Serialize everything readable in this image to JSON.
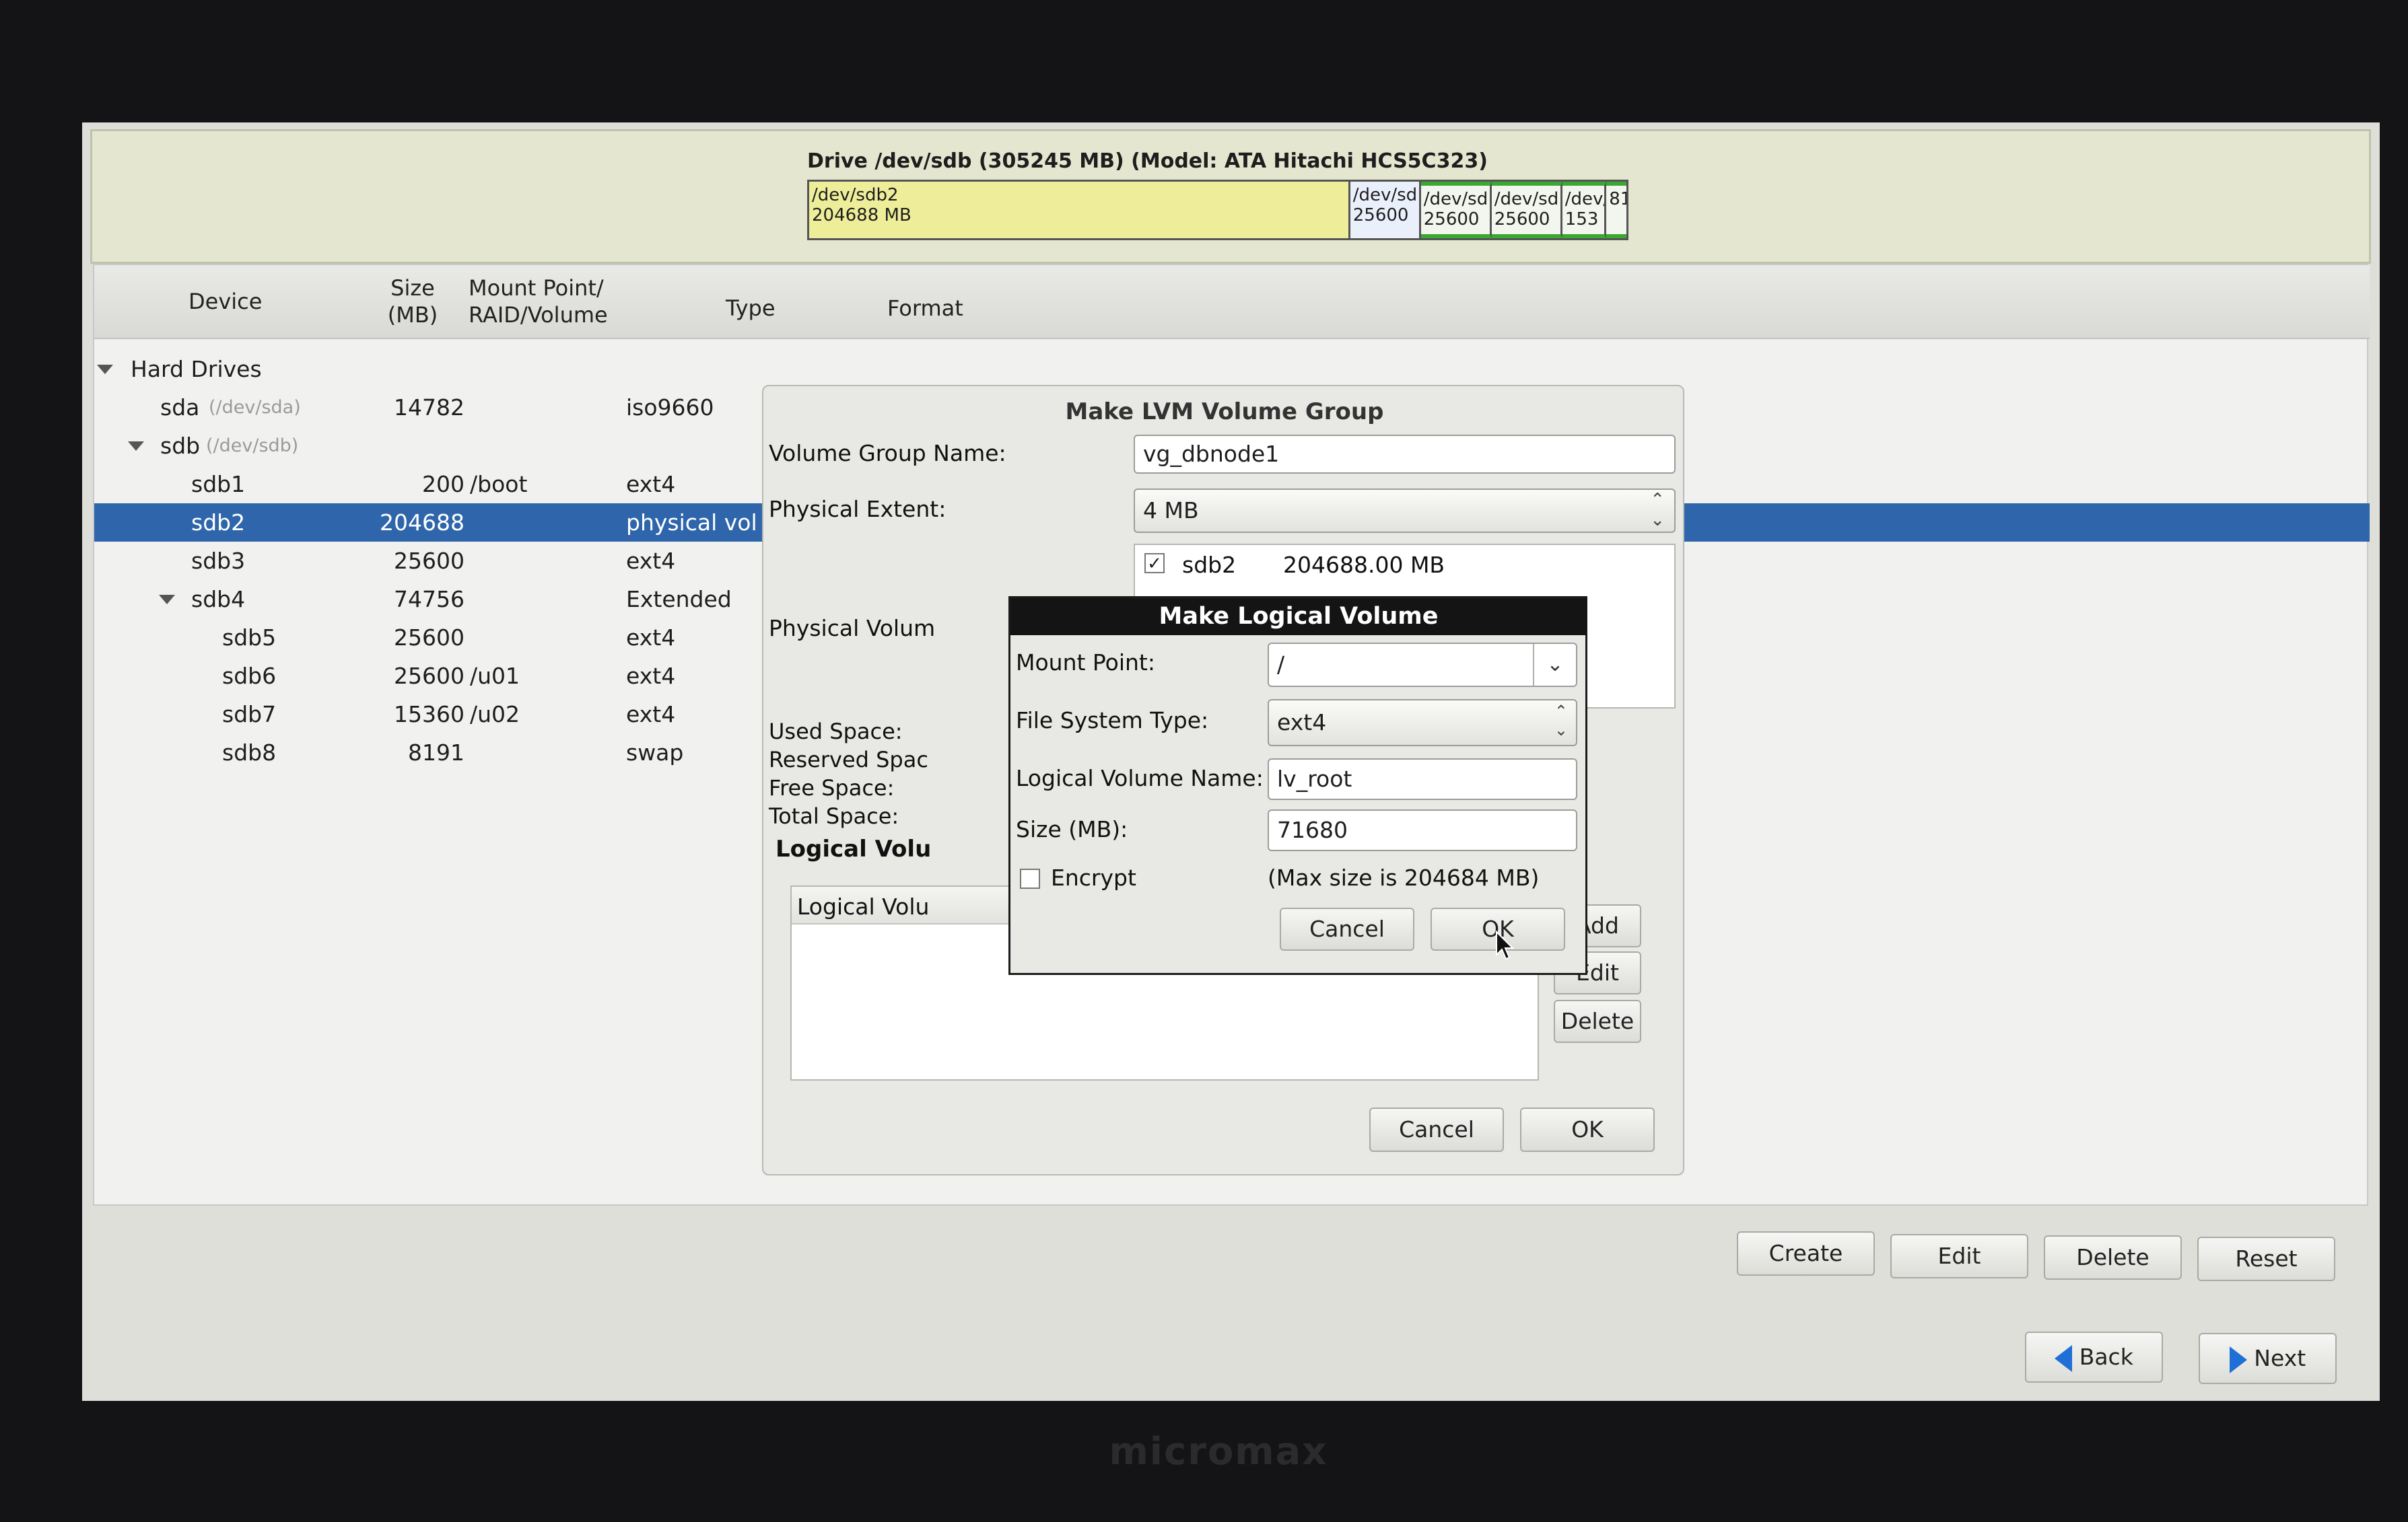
{
  "bezel": {
    "brand": "micromax"
  },
  "drive": {
    "title": "Drive /dev/sdb (305245 MB) (Model: ATA Hitachi HCS5C323)",
    "segments": [
      {
        "name": "/dev/sdb2",
        "size": "204688 MB"
      },
      {
        "name": "/dev/sd",
        "size": "25600"
      },
      {
        "name": "/dev/sd",
        "size": "25600"
      },
      {
        "name": "/dev/sd",
        "size": "25600"
      },
      {
        "name": "/dev/d",
        "size": "153"
      },
      {
        "name": "",
        "size": "81"
      }
    ]
  },
  "table": {
    "headers": {
      "device": "Device",
      "size": "Size\n(MB)",
      "mount": "Mount Point/\nRAID/Volume",
      "type": "Type",
      "format": "Format"
    },
    "group": "Hard Drives",
    "rows": [
      {
        "device": "sda",
        "path": "(/dev/sda)",
        "size": "14782",
        "mount": "",
        "type": "iso9660"
      },
      {
        "device": "sdb",
        "path": "(/dev/sdb)",
        "size": "",
        "mount": "",
        "type": ""
      },
      {
        "device": "sdb1",
        "path": "",
        "size": "200",
        "mount": "/boot",
        "type": "ext4"
      },
      {
        "device": "sdb2",
        "path": "",
        "size": "204688",
        "mount": "",
        "type": "physical vol"
      },
      {
        "device": "sdb3",
        "path": "",
        "size": "25600",
        "mount": "",
        "type": "ext4"
      },
      {
        "device": "sdb4",
        "path": "",
        "size": "74756",
        "mount": "",
        "type": "Extended"
      },
      {
        "device": "sdb5",
        "path": "",
        "size": "25600",
        "mount": "",
        "type": "ext4"
      },
      {
        "device": "sdb6",
        "path": "",
        "size": "25600",
        "mount": "/u01",
        "type": "ext4"
      },
      {
        "device": "sdb7",
        "path": "",
        "size": "15360",
        "mount": "/u02",
        "type": "ext4"
      },
      {
        "device": "sdb8",
        "path": "",
        "size": "8191",
        "mount": "",
        "type": "swap"
      }
    ]
  },
  "lvm": {
    "title": "Make LVM Volume Group",
    "vg_name_label": "Volume Group Name:",
    "vg_name": "vg_dbnode1",
    "extent_label": "Physical Extent:",
    "extent": "4 MB",
    "pv_label": "Physical Volum",
    "pv_name": "sdb2",
    "pv_size": "204688.00 MB",
    "used_label": "Used Space:",
    "reserved_label": "Reserved Spac",
    "free_label": "Free Space:",
    "total_label": "Total Space:",
    "lv_heading": "Logical Volu",
    "lv_col": "Logical Volu",
    "add": "Add",
    "edit": "Edit",
    "delete": "Delete",
    "cancel": "Cancel",
    "ok": "OK"
  },
  "mlv": {
    "title": "Make Logical Volume",
    "mount_label": "Mount Point:",
    "mount": "/",
    "fs_label": "File System Type:",
    "fs": "ext4",
    "name_label": "Logical Volume Name:",
    "name": "lv_root",
    "size_label": "Size (MB):",
    "size": "71680",
    "encrypt_label": "Encrypt",
    "max_note": "(Max size is 204684 MB)",
    "cancel": "Cancel",
    "ok": "OK"
  },
  "actions": {
    "create": "Create",
    "edit": "Edit",
    "delete": "Delete",
    "reset": "Reset",
    "back": "Back",
    "next": "Next"
  },
  "colors": {
    "selection": "#2f66ab",
    "drive_free": "#eeee9a",
    "arrow": "#1f6fd6"
  }
}
